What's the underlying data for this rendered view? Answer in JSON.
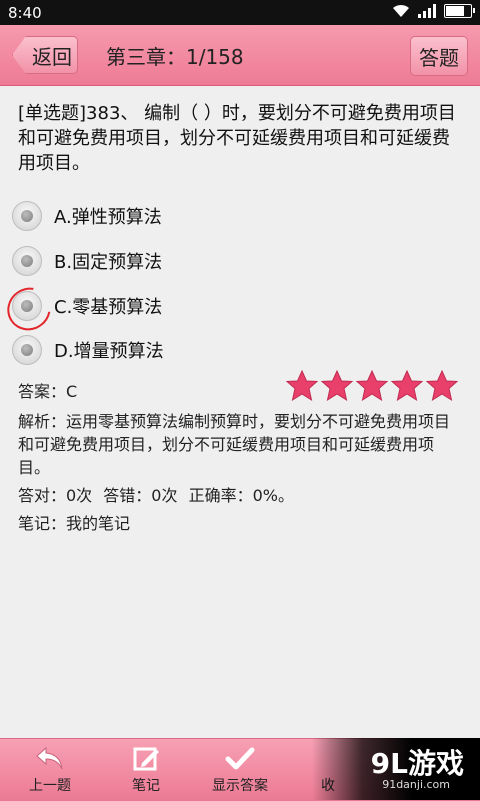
{
  "status_bar": {
    "time": "8:40"
  },
  "header": {
    "back_label": "返回",
    "title": "第三章：1/158",
    "answer_label": "答题"
  },
  "question": {
    "text": "[单选题]383、 编制（ ）时，要划分不可避免费用项目和可避免费用项目，划分不可延缓费用项目和可延缓费用项目。",
    "options": [
      {
        "label": "A.弹性预算法"
      },
      {
        "label": "B.固定预算法"
      },
      {
        "label": "C.零基预算法"
      },
      {
        "label": "D.增量预算法"
      }
    ]
  },
  "answer": {
    "text": "答案：C",
    "rating": 5,
    "rating_max": 5,
    "star_color": "#e8406a"
  },
  "analysis": "解析：运用零基预算法编制预算时，要划分不可避免费用项目和可避免费用项目，划分不可延缓费用项目和可延缓费用项目。",
  "stats": {
    "correct": "答对：0次",
    "wrong": "答错：0次",
    "rate": "正确率：0%。"
  },
  "note": "笔记：我的笔记",
  "bottom_nav": {
    "prev": "上一题",
    "notes": "笔记",
    "show_answer": "显示答案",
    "collect": "收"
  },
  "watermark": {
    "logo": "9L游戏",
    "url": "91danji.com"
  }
}
